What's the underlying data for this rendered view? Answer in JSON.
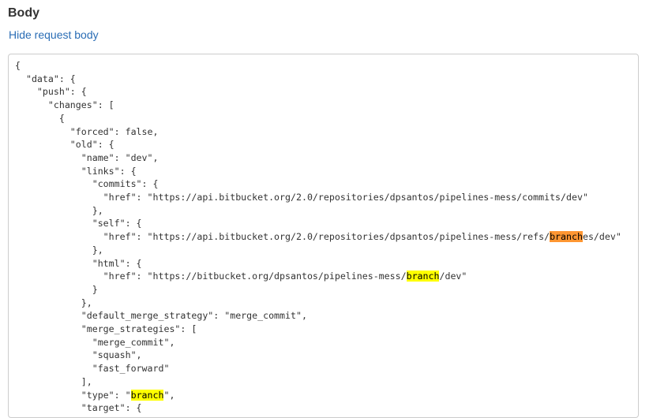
{
  "section_title": "Body",
  "toggle_label": "Hide request body",
  "colors": {
    "link": "#2a6db5",
    "highlight": "#ffff00",
    "current_match": "#ff9632"
  },
  "search_term": "branch",
  "lines": [
    {
      "pre": "{"
    },
    {
      "pre": "  \"data\": {"
    },
    {
      "pre": "    \"push\": {"
    },
    {
      "pre": "      \"changes\": ["
    },
    {
      "pre": "        {"
    },
    {
      "pre": "          \"forced\": false,"
    },
    {
      "pre": "          \"old\": {"
    },
    {
      "pre": "            \"name\": \"dev\","
    },
    {
      "pre": "            \"links\": {"
    },
    {
      "pre": "              \"commits\": {"
    },
    {
      "pre": "                \"href\": \"https://api.bitbucket.org/2.0/repositories/dpsantos/pipelines-mess/commits/dev\""
    },
    {
      "pre": "              },"
    },
    {
      "pre": "              \"self\": {"
    },
    {
      "pre": "                \"href\": \"https://api.bitbucket.org/2.0/repositories/dpsantos/pipelines-mess/refs/",
      "hl": "branch",
      "hl_type": "orange",
      "post": "es/dev\""
    },
    {
      "pre": "              },"
    },
    {
      "pre": "              \"html\": {"
    },
    {
      "pre": "                \"href\": \"https://bitbucket.org/dpsantos/pipelines-mess/",
      "hl": "branch",
      "hl_type": "yellow",
      "post": "/dev\""
    },
    {
      "pre": "              }"
    },
    {
      "pre": "            },"
    },
    {
      "pre": "            \"default_merge_strategy\": \"merge_commit\","
    },
    {
      "pre": "            \"merge_strategies\": ["
    },
    {
      "pre": "              \"merge_commit\","
    },
    {
      "pre": "              \"squash\","
    },
    {
      "pre": "              \"fast_forward\""
    },
    {
      "pre": "            ],"
    },
    {
      "pre": "            \"type\": \"",
      "hl": "branch",
      "hl_type": "yellow",
      "post": "\","
    },
    {
      "pre": "            \"target\": {"
    }
  ]
}
